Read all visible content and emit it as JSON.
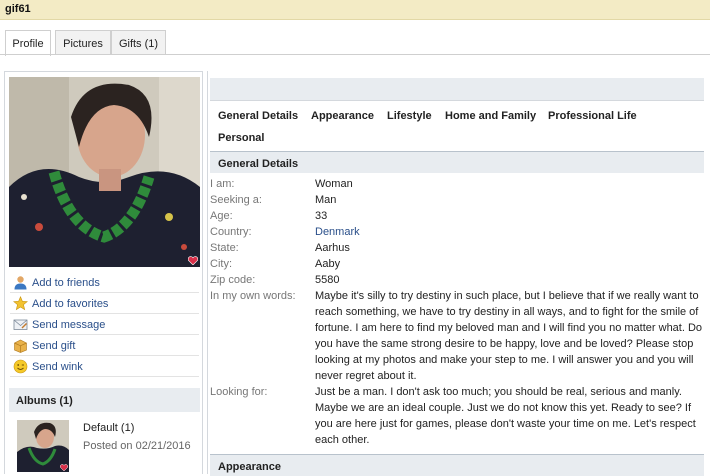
{
  "header": {
    "title": "gif61"
  },
  "tabs": [
    {
      "label": "Profile",
      "active": true
    },
    {
      "label": "Pictures"
    },
    {
      "label": "Gifts (1)"
    }
  ],
  "actions": [
    {
      "label": "Add to friends",
      "icon": "person-icon"
    },
    {
      "label": "Add to favorites",
      "icon": "star-icon"
    },
    {
      "label": "Send message",
      "icon": "envelope-icon"
    },
    {
      "label": "Send gift",
      "icon": "gift-icon"
    },
    {
      "label": "Send wink",
      "icon": "smiley-icon"
    }
  ],
  "albums": {
    "title": "Albums (1)",
    "items": [
      {
        "name": "Default (1)",
        "posted": "Posted on 02/21/2016"
      }
    ]
  },
  "nav": [
    "General Details",
    "Appearance",
    "Lifestyle",
    "Home and Family",
    "Professional Life",
    "Personal"
  ],
  "general": {
    "title": "General Details",
    "rows": [
      {
        "label": "I am:",
        "value": "Woman"
      },
      {
        "label": "Seeking a:",
        "value": "Man"
      },
      {
        "label": "Age:",
        "value": "33"
      },
      {
        "label": "Country:",
        "value": "Denmark"
      },
      {
        "label": "State:",
        "value": "Aarhus"
      },
      {
        "label": "City:",
        "value": "Aaby"
      },
      {
        "label": "Zip code:",
        "value": "5580"
      },
      {
        "label": "In my own words:",
        "value": "Maybe it's silly to try destiny in such place, but I believe that if we really want to reach something, we have to try destiny in all ways, and to fight for the smile of fortune. I am here to find my beloved man and I will find you no matter what. Do you have the same strong desire to be happy, love and be loved? Please stop looking at my photos and make your step to me. I will answer you and you will never regret about it."
      },
      {
        "label": "Looking for:",
        "value": "Just be a man. I don't ask too much; you should be real, serious and manly. Maybe we are an ideal couple. Just we do not know this yet. Ready to see? If you are here just for games, please don't waste your time on me. Let's respect each other."
      }
    ]
  },
  "appearance": {
    "title": "Appearance"
  },
  "colors": {
    "accent_link": "#2a4f8a",
    "title_bar": "#f3ebc5",
    "section_bg": "#e8ecf0",
    "heart": "#d9304a"
  }
}
